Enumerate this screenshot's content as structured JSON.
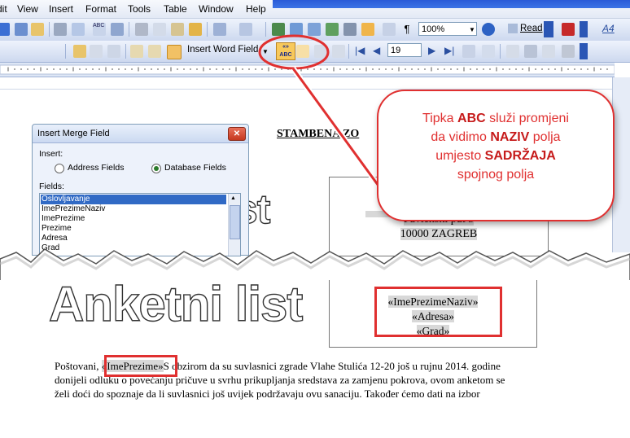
{
  "menubar": {
    "items": [
      "Edit",
      "View",
      "Insert",
      "Format",
      "Tools",
      "Table",
      "Window",
      "Help"
    ]
  },
  "toolbar": {
    "zoom_value": "100%",
    "read_label": "Read",
    "insert_word_field_label": "Insert Word Field",
    "record_number": "19",
    "abc_button_label": "ABC"
  },
  "document": {
    "header_fragment": "STAMBENA ZO",
    "anketni_fragment": "ist",
    "address_line1": "Pavlenski put 5",
    "address_line2": "10000 ZAGREB",
    "anketni_title": "Anketni list",
    "field_ime_prezime_naziv": "«ImePrezimeNaziv»",
    "field_adresa": "«Adresa»",
    "field_grad": "«Grad»",
    "para_prefix": "Poštovani, ",
    "field_ime_prezime": "«ImePrezime»",
    "para_line1_rest": "S obzirom da su suvlasnici zgrade Vlahe Stulića 12-20 još u rujnu 2014. godine",
    "para_line2": "donijeli odluku o povećanju pričuve u svrhu prikupljanja sredstava za zamjenu pokrova, ovom anketom se",
    "para_line3": "želi doći do spoznaje da li suvlasnici još uvijek podržavaju ovu sanaciju. Također ćemo dati na izbor"
  },
  "dialog": {
    "title": "Insert Merge Field",
    "insert_label": "Insert:",
    "address_fields": "Address Fields",
    "database_fields": "Database Fields",
    "fields_label": "Fields:",
    "fields": [
      "Oslovljavanje",
      "ImePrezimeNaziv",
      "ImePrezime",
      "Prezime",
      "Adresa",
      "Grad"
    ]
  },
  "callout": {
    "line1_prefix": "Tipka  ",
    "line1_bold": "ABC",
    "line1_suffix": " služi promjeni",
    "line2_prefix": "da vidimo ",
    "line2_bold": "NAZIV",
    "line2_suffix": " polja",
    "line3_prefix": "umjesto ",
    "line3_bold": "SADRŽAJA",
    "line4": "spojnog polja"
  },
  "colors": {
    "highlight_red": "#e03030",
    "field_shading": "#d8d8d8",
    "selection_blue": "#316ac5"
  }
}
